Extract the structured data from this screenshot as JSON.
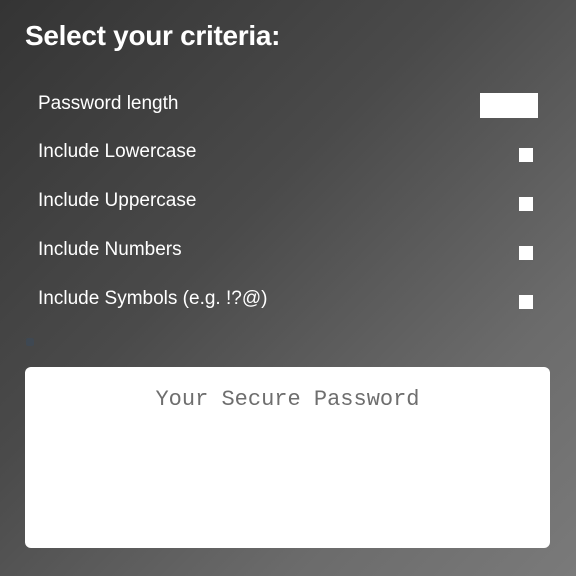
{
  "heading": "Select your criteria:",
  "criteria": {
    "length_label": "Password length",
    "length_value": "",
    "lowercase_label": "Include Lowercase",
    "uppercase_label": "Include Uppercase",
    "numbers_label": "Include Numbers",
    "symbols_label": "Include Symbols (e.g. !?@)"
  },
  "output": {
    "placeholder": "Your Secure Password",
    "value": ""
  }
}
